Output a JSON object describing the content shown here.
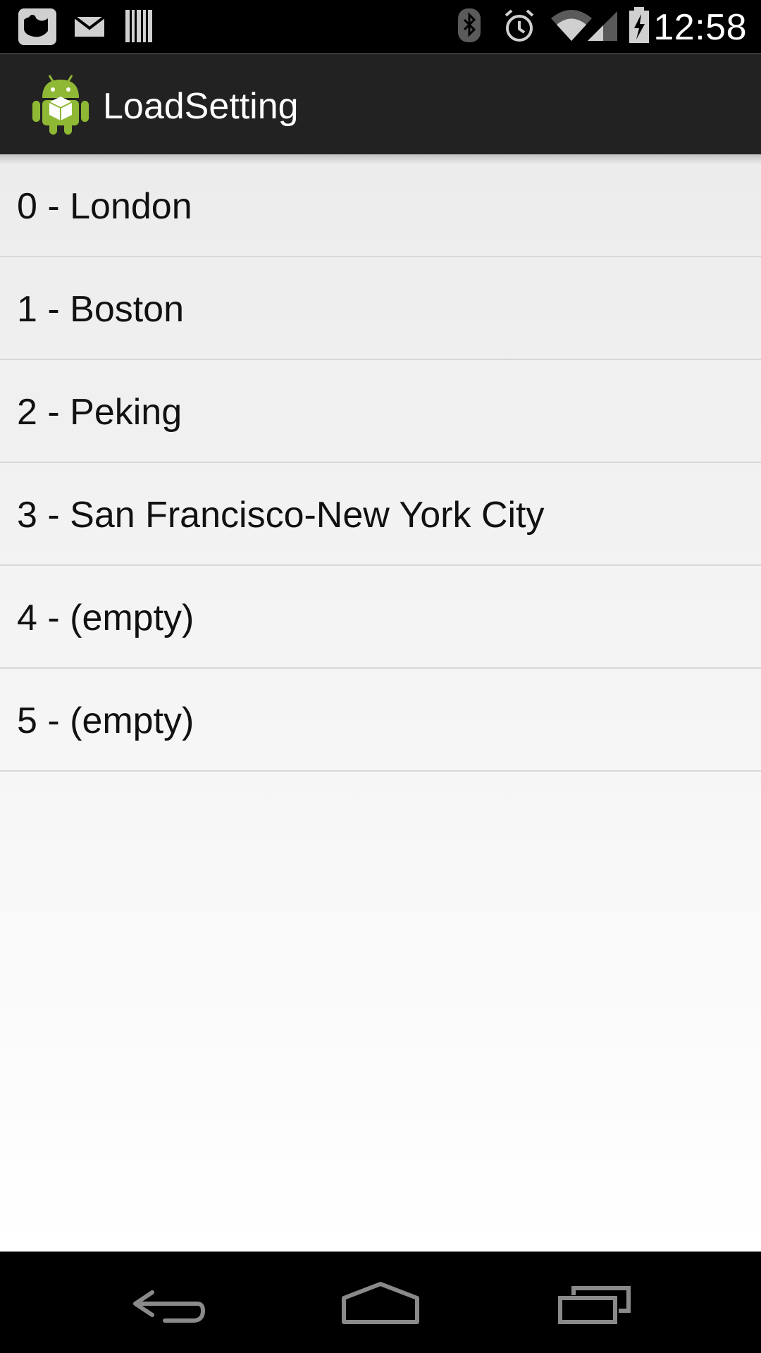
{
  "status_bar": {
    "time": "12:58",
    "left_icons": [
      "photo-app-notification-icon",
      "gmail-notification-icon",
      "barcode-notification-icon"
    ],
    "right_icons": [
      "bluetooth-icon",
      "alarm-icon",
      "wifi-icon",
      "cell-signal-icon",
      "battery-charging-icon"
    ]
  },
  "action_bar": {
    "title": "LoadSetting",
    "icon": "android-app-icon"
  },
  "list": {
    "items": [
      {
        "label": "0 - London"
      },
      {
        "label": "1 - Boston"
      },
      {
        "label": "2 - Peking"
      },
      {
        "label": "3 - San Francisco-New York City"
      },
      {
        "label": "4 - (empty)"
      },
      {
        "label": "5 - (empty)"
      }
    ]
  },
  "nav_bar": {
    "buttons": [
      "back-icon",
      "home-icon",
      "recents-icon"
    ]
  },
  "colors": {
    "action_bar_bg": "#222222",
    "list_text": "#111111",
    "divider": "#d8d8d8",
    "android_green": "#8fb935"
  }
}
